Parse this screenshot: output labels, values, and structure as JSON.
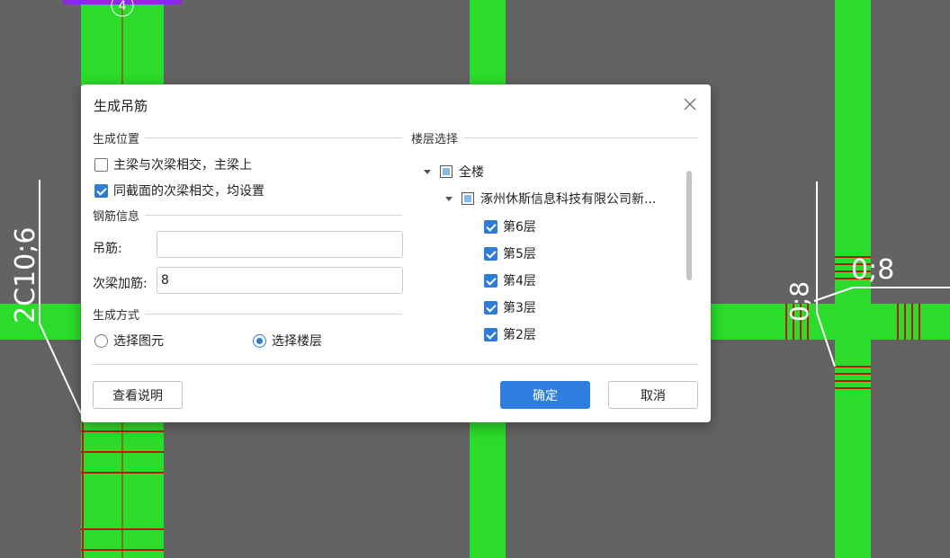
{
  "cad": {
    "label_left": "2C10;6",
    "label_right_horizontal": "0;8",
    "label_right_vertical": "0;8",
    "marker_number": "4",
    "colors": {
      "background": "#636363",
      "beam": "#2bdc2b",
      "rebar": "#c0160d",
      "leader": "#ffffff",
      "marker": "#8a2be2"
    }
  },
  "dialog": {
    "title": "生成吊筋",
    "close_icon": "close-icon",
    "position_section": {
      "title": "生成位置",
      "options": [
        {
          "label": "主梁与次梁相交，主梁上",
          "checked": false
        },
        {
          "label": "同截面的次梁相交，均设置",
          "checked": true
        }
      ]
    },
    "rebar_section": {
      "title": "钢筋信息",
      "hanger_label": "吊筋:",
      "hanger_value": "",
      "secondary_label": "次梁加筋:",
      "secondary_value": "8"
    },
    "method_section": {
      "title": "生成方式",
      "options": [
        {
          "label": "选择图元",
          "selected": false
        },
        {
          "label": "选择楼层",
          "selected": true
        }
      ]
    },
    "floor_section": {
      "title": "楼层选择",
      "all_label": "全楼",
      "project_label": "涿州休斯信息科技有限公司新...",
      "floors": [
        {
          "label": "第6层",
          "checked": true
        },
        {
          "label": "第5层",
          "checked": true
        },
        {
          "label": "第4层",
          "checked": true
        },
        {
          "label": "第3层",
          "checked": true
        },
        {
          "label": "第2层",
          "checked": true
        }
      ]
    },
    "buttons": {
      "help": "查看说明",
      "ok": "确定",
      "cancel": "取消"
    },
    "colors": {
      "accent": "#2f7fe0"
    }
  }
}
